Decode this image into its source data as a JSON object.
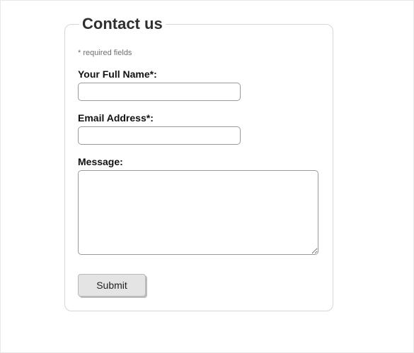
{
  "form": {
    "title": "Contact us",
    "required_note": "* required fields",
    "fields": {
      "name": {
        "label": "Your Full Name*:",
        "value": ""
      },
      "email": {
        "label": "Email Address*:",
        "value": ""
      },
      "message": {
        "label": "Message:",
        "value": ""
      }
    },
    "submit_label": "Submit"
  }
}
